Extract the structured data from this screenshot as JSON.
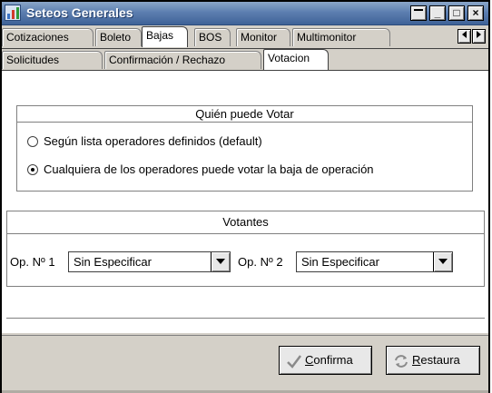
{
  "window": {
    "title": "Seteos Generales",
    "buttons": {
      "extra": "",
      "minimize": "_",
      "maximize": "□",
      "close": "×"
    }
  },
  "main_tabs": [
    {
      "label": "Cotizaciones",
      "selected": false
    },
    {
      "label": "Boleto",
      "selected": false
    },
    {
      "label": "Bajas",
      "selected": true
    },
    {
      "label": "BOS",
      "selected": false
    },
    {
      "label": "Monitor",
      "selected": false
    },
    {
      "label": "Multimonitor",
      "selected": false
    }
  ],
  "tab_scroll": {
    "left_icon": "arrow-left-icon",
    "right_icon": "arrow-right-icon"
  },
  "sub_tabs": [
    {
      "label": "Solicitudes",
      "selected": false
    },
    {
      "label": "Confirmación / Rechazo",
      "selected": false
    },
    {
      "label": "Votacion",
      "selected": true
    }
  ],
  "quien_puede_votar": {
    "title": "Quién puede Votar",
    "options": [
      {
        "label": "Según lista operadores definidos (default)",
        "checked": false
      },
      {
        "label": "Cualquiera de los operadores puede votar la baja de operación",
        "checked": true
      }
    ]
  },
  "votantes": {
    "title": "Votantes",
    "op1": {
      "label": "Op. Nº 1",
      "value": "Sin Especificar"
    },
    "op2": {
      "label": "Op. Nº 2",
      "value": "Sin Especificar"
    }
  },
  "actions": {
    "confirm": {
      "mnemonic": "C",
      "rest": "onfirma",
      "icon": "checkmark-icon"
    },
    "restore": {
      "mnemonic": "R",
      "rest": "estaura",
      "icon": "restore-arrows-icon"
    }
  },
  "colors": {
    "title_gradient_top": "#8aa6c8",
    "title_gradient_bottom": "#3f6298",
    "face": "#d4d0c8"
  }
}
